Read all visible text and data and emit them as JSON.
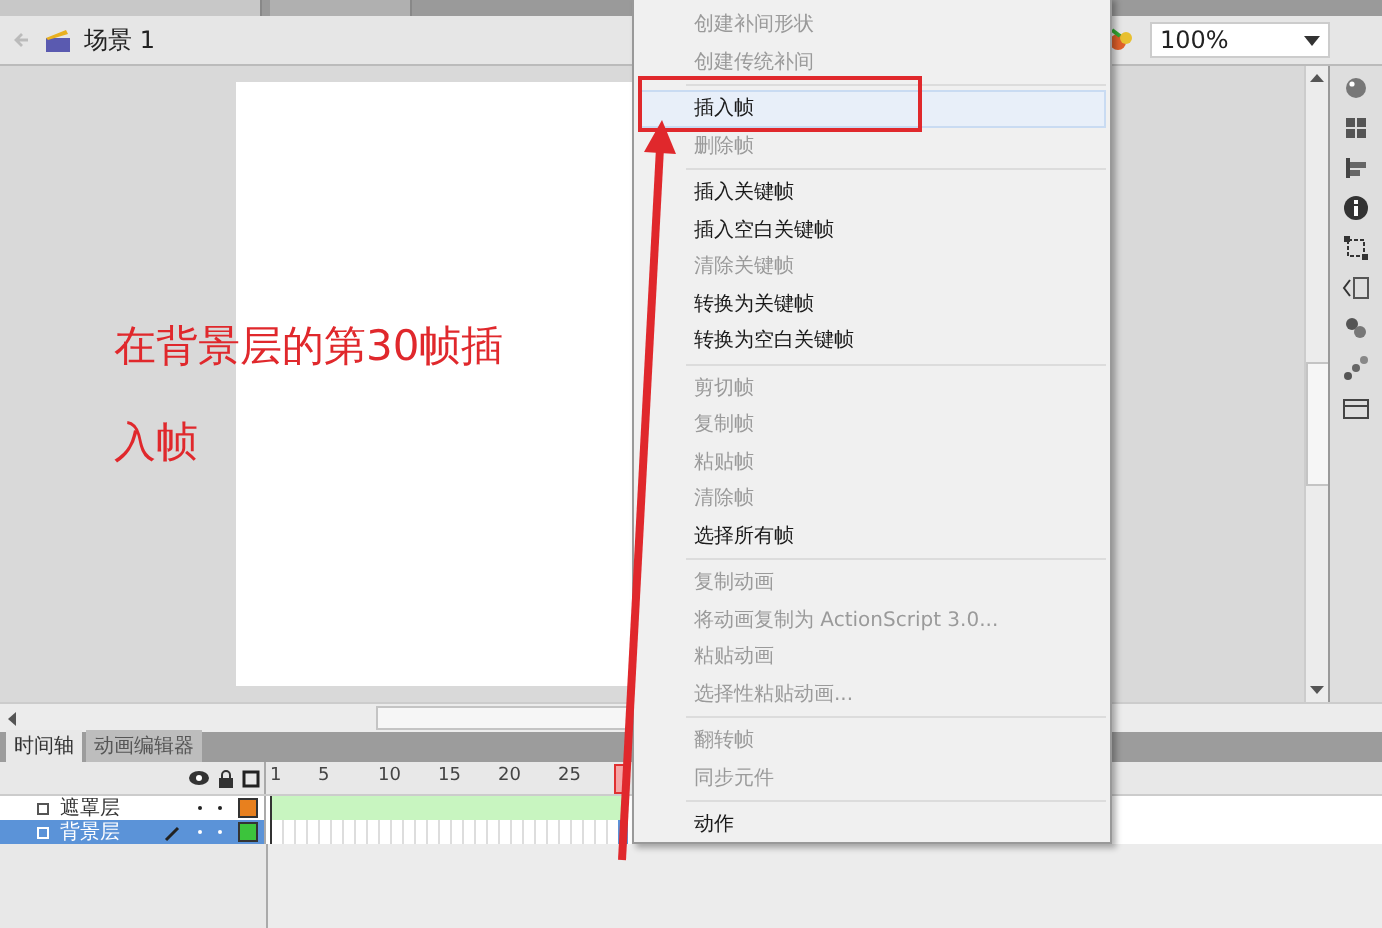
{
  "scene_bar": {
    "scene": "场景 1",
    "zoom": "100%"
  },
  "annotation": {
    "text": "在背景层的第30帧插入帧"
  },
  "timeline_tabs": [
    {
      "label": "时间轴",
      "selected": true
    },
    {
      "label": "动画编辑器",
      "selected": false
    }
  ],
  "frame_ruler": [
    "1",
    "5",
    "10",
    "15",
    "20",
    "25"
  ],
  "layers": [
    {
      "name": "遮罩层",
      "selected": false,
      "kind": "tween",
      "color": "#e8801e"
    },
    {
      "name": "背景层",
      "selected": true,
      "kind": "static",
      "color": "#3cc43c"
    }
  ],
  "context_menu": [
    {
      "kind": "item",
      "label": "创建补间形状",
      "disabled": true,
      "selected": false
    },
    {
      "kind": "item",
      "label": "创建传统补间",
      "disabled": true,
      "selected": false
    },
    {
      "kind": "separator"
    },
    {
      "kind": "item",
      "label": "插入帧",
      "disabled": false,
      "selected": true
    },
    {
      "kind": "item",
      "label": "删除帧",
      "disabled": true,
      "selected": false
    },
    {
      "kind": "separator"
    },
    {
      "kind": "item",
      "label": "插入关键帧",
      "disabled": false,
      "selected": false
    },
    {
      "kind": "item",
      "label": "插入空白关键帧",
      "disabled": false,
      "selected": false
    },
    {
      "kind": "item",
      "label": "清除关键帧",
      "disabled": true,
      "selected": false
    },
    {
      "kind": "item",
      "label": "转换为关键帧",
      "disabled": false,
      "selected": false
    },
    {
      "kind": "item",
      "label": "转换为空白关键帧",
      "disabled": false,
      "selected": false
    },
    {
      "kind": "separator"
    },
    {
      "kind": "item",
      "label": "剪切帧",
      "disabled": true,
      "selected": false
    },
    {
      "kind": "item",
      "label": "复制帧",
      "disabled": true,
      "selected": false
    },
    {
      "kind": "item",
      "label": "粘贴帧",
      "disabled": true,
      "selected": false
    },
    {
      "kind": "item",
      "label": "清除帧",
      "disabled": true,
      "selected": false
    },
    {
      "kind": "item",
      "label": "选择所有帧",
      "disabled": false,
      "selected": false
    },
    {
      "kind": "separator"
    },
    {
      "kind": "item",
      "label": "复制动画",
      "disabled": true,
      "selected": false
    },
    {
      "kind": "item",
      "label": "将动画复制为 ActionScript 3.0...",
      "disabled": true,
      "selected": false
    },
    {
      "kind": "item",
      "label": "粘贴动画",
      "disabled": true,
      "selected": false
    },
    {
      "kind": "item",
      "label": "选择性粘贴动画...",
      "disabled": true,
      "selected": false
    },
    {
      "kind": "separator"
    },
    {
      "kind": "item",
      "label": "翻转帧",
      "disabled": true,
      "selected": false
    },
    {
      "kind": "item",
      "label": "同步元件",
      "disabled": true,
      "selected": false
    },
    {
      "kind": "separator"
    },
    {
      "kind": "item",
      "label": "动作",
      "disabled": false,
      "selected": false
    }
  ]
}
